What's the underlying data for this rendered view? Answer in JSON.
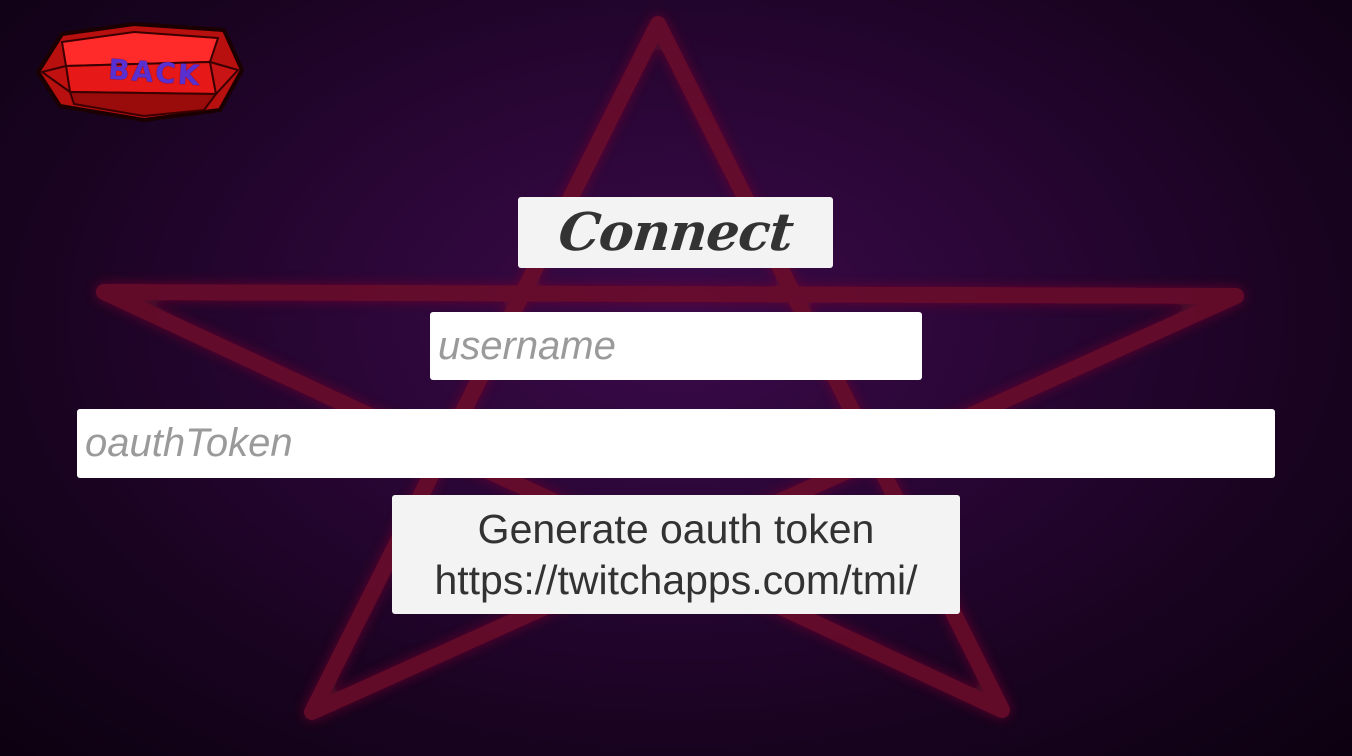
{
  "back_button": {
    "label": "BACK",
    "icon": "red-gem-icon",
    "color": "#e01010"
  },
  "background": {
    "icon": "pentagram-icon",
    "star_color": "#7a0a2a",
    "base_color": "#2a0636"
  },
  "connect_button": {
    "label": "Connect"
  },
  "username_field": {
    "value": "",
    "placeholder": "username"
  },
  "oauth_field": {
    "value": "",
    "placeholder": "oauthToken"
  },
  "generate_button": {
    "line1": "Generate oauth token",
    "line2": "https://twitchapps.com/tmi/"
  }
}
